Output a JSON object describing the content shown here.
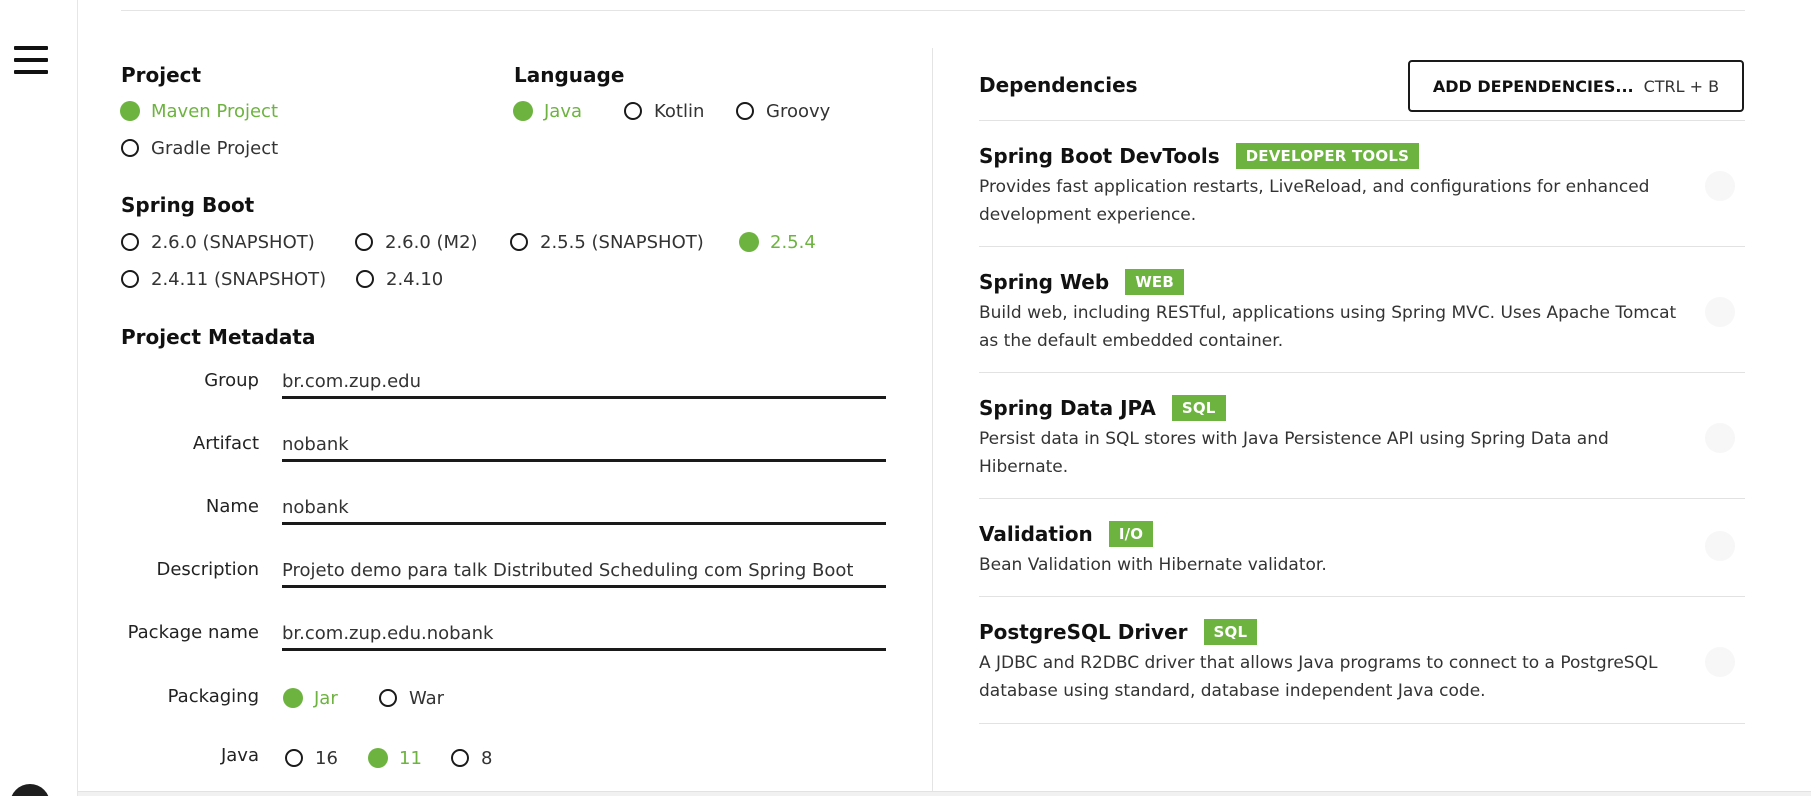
{
  "project": {
    "title": "Project",
    "options": [
      {
        "label": "Maven Project",
        "checked": true
      },
      {
        "label": "Gradle Project",
        "checked": false
      }
    ]
  },
  "language": {
    "title": "Language",
    "options": [
      {
        "label": "Java",
        "checked": true
      },
      {
        "label": "Kotlin",
        "checked": false
      },
      {
        "label": "Groovy",
        "checked": false
      }
    ]
  },
  "spring_boot": {
    "title": "Spring Boot",
    "options": [
      {
        "label": "2.6.0 (SNAPSHOT)",
        "checked": false
      },
      {
        "label": "2.6.0 (M2)",
        "checked": false
      },
      {
        "label": "2.5.5 (SNAPSHOT)",
        "checked": false
      },
      {
        "label": "2.5.4",
        "checked": true
      },
      {
        "label": "2.4.11 (SNAPSHOT)",
        "checked": false
      },
      {
        "label": "2.4.10",
        "checked": false
      }
    ]
  },
  "metadata": {
    "title": "Project Metadata",
    "group": {
      "label": "Group",
      "value": "br.com.zup.edu"
    },
    "artifact": {
      "label": "Artifact",
      "value": "nobank"
    },
    "name": {
      "label": "Name",
      "value": "nobank"
    },
    "description": {
      "label": "Description",
      "value": "Projeto demo para talk Distributed Scheduling com Spring Boot"
    },
    "package_name": {
      "label": "Package name",
      "value": "br.com.zup.edu.nobank"
    },
    "packaging": {
      "label": "Packaging",
      "options": [
        {
          "label": "Jar",
          "checked": true
        },
        {
          "label": "War",
          "checked": false
        }
      ]
    },
    "java": {
      "label": "Java",
      "options": [
        {
          "label": "16",
          "checked": false
        },
        {
          "label": "11",
          "checked": true
        },
        {
          "label": "8",
          "checked": false
        }
      ]
    }
  },
  "dependencies": {
    "title": "Dependencies",
    "add_button": {
      "label": "ADD DEPENDENCIES...",
      "shortcut": "CTRL + B"
    },
    "items": [
      {
        "name": "Spring Boot DevTools",
        "tag": "DEVELOPER TOOLS",
        "description": "Provides fast application restarts, LiveReload, and configurations for enhanced development experience."
      },
      {
        "name": "Spring Web",
        "tag": "WEB",
        "description": "Build web, including RESTful, applications using Spring MVC. Uses Apache Tomcat as the default embedded container."
      },
      {
        "name": "Spring Data JPA",
        "tag": "SQL",
        "description": "Persist data in SQL stores with Java Persistence API using Spring Data and Hibernate."
      },
      {
        "name": "Validation",
        "tag": "I/O",
        "description": "Bean Validation with Hibernate validator."
      },
      {
        "name": "PostgreSQL Driver",
        "tag": "SQL",
        "description": "A JDBC and R2DBC driver that allows Java programs to connect to a PostgreSQL database using standard, database independent Java code."
      }
    ]
  },
  "colors": {
    "accent": "#6db33f",
    "text": "#1e1e1e",
    "border": "#1a1a1a"
  }
}
